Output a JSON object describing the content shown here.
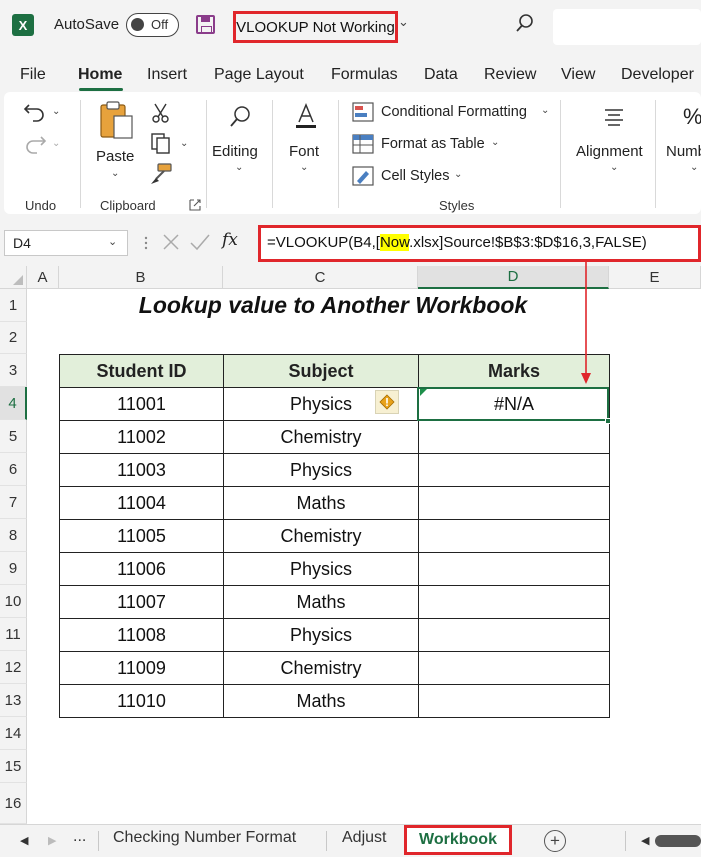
{
  "titlebar": {
    "app_logo": "X",
    "autosave_label": "AutoSave",
    "autosave_state": "Off",
    "document_title": "VLOOKUP Not Working",
    "icons": [
      "excel-logo-icon",
      "save-icon",
      "chevron-down-icon",
      "search-icon"
    ]
  },
  "ribbon_tabs": [
    "File",
    "Home",
    "Insert",
    "Page Layout",
    "Formulas",
    "Data",
    "Review",
    "View",
    "Developer"
  ],
  "active_ribbon_tab": "Home",
  "ribbon": {
    "undo_group_label": "Undo",
    "clipboard_group_label": "Clipboard",
    "paste_label": "Paste",
    "editing_label": "Editing",
    "font_label": "Font",
    "conditional_formatting": "Conditional Formatting",
    "format_as_table": "Format as Table",
    "cell_styles": "Cell Styles",
    "styles_group_label": "Styles",
    "alignment_label": "Alignment",
    "number_label_partial": "Numb",
    "percent_symbol": "%"
  },
  "formula_bar": {
    "name_box": "D4",
    "fx": "fx",
    "formula_before": "=VLOOKUP(B4,[",
    "formula_highlight": "Now",
    "formula_after": ".xlsx]Source!$B$3:$D$16,3,FALSE)"
  },
  "sheet": {
    "columns": [
      "A",
      "B",
      "C",
      "D",
      "E"
    ],
    "selected_column": "D",
    "rows": [
      "1",
      "2",
      "3",
      "4",
      "5",
      "6",
      "7",
      "8",
      "9",
      "10",
      "11",
      "12",
      "13",
      "14",
      "15",
      "16"
    ],
    "selected_row": "4",
    "title": "Lookup value to Another Workbook",
    "table_headers": [
      "Student ID",
      "Subject",
      "Marks"
    ],
    "table_rows": [
      [
        "11001",
        "Physics",
        "#N/A"
      ],
      [
        "11002",
        "Chemistry",
        ""
      ],
      [
        "11003",
        "Physics",
        ""
      ],
      [
        "11004",
        "Maths",
        ""
      ],
      [
        "11005",
        "Chemistry",
        ""
      ],
      [
        "11006",
        "Physics",
        ""
      ],
      [
        "11007",
        "Maths",
        ""
      ],
      [
        "11008",
        "Physics",
        ""
      ],
      [
        "11009",
        "Chemistry",
        ""
      ],
      [
        "11010",
        "Maths",
        ""
      ]
    ],
    "warning_icon": "error-warning-icon"
  },
  "sheet_tabs": {
    "ellipsis": "...",
    "tabs": [
      "Checking Number Format",
      "Adjust"
    ],
    "active_tab": "Workbook",
    "add_label": "+"
  },
  "colors": {
    "excel_green": "#1d6f42",
    "annotation_red": "#e0262b",
    "header_fill": "#e2efda",
    "highlight_yellow": "#ffff00"
  }
}
